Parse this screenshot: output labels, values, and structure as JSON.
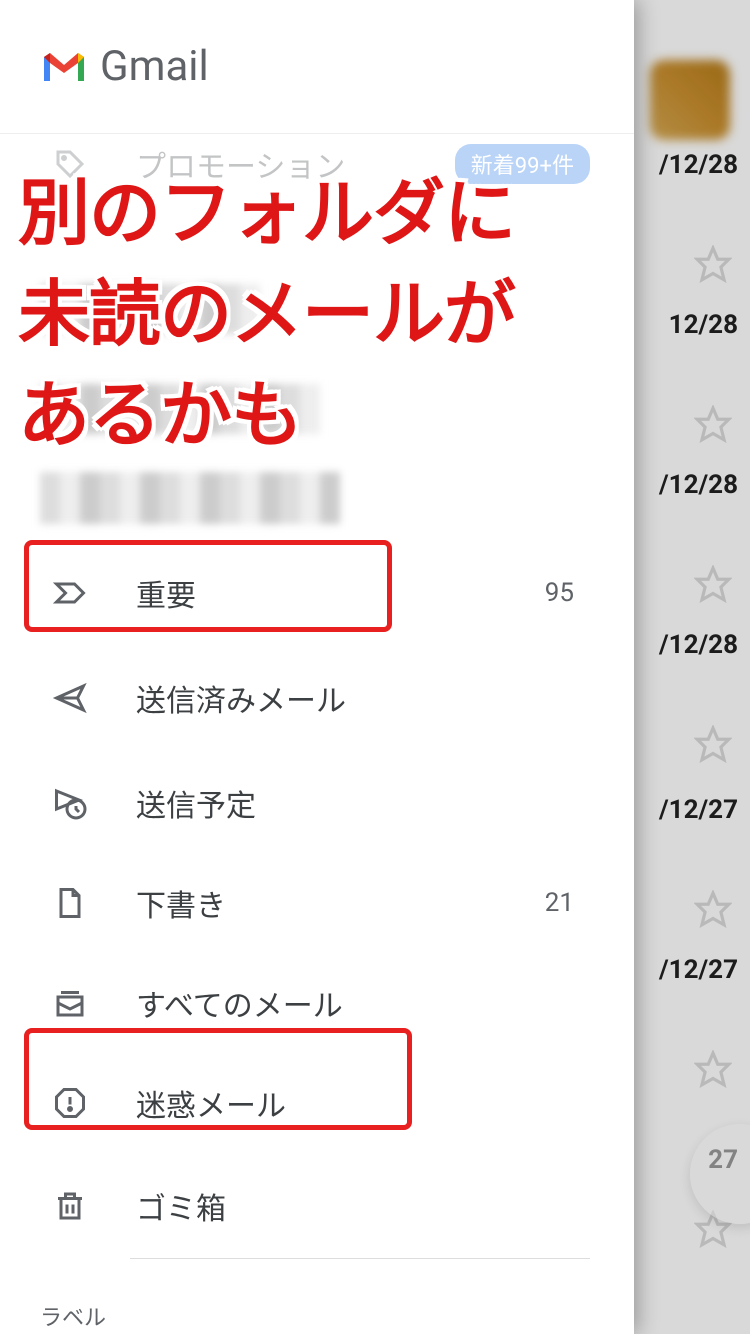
{
  "header": {
    "app_name": "Gmail"
  },
  "nav": {
    "promotions": {
      "label": "プロモーション",
      "badge": "新着99+件"
    },
    "important": {
      "label": "重要",
      "count": "95"
    },
    "sent": {
      "label": "送信済みメール"
    },
    "scheduled": {
      "label": "送信予定"
    },
    "drafts": {
      "label": "下書き",
      "count": "21"
    },
    "all_mail": {
      "label": "すべてのメール"
    },
    "spam": {
      "label": "迷惑メール"
    },
    "trash": {
      "label": "ゴミ箱"
    }
  },
  "section": {
    "labels": "ラベル"
  },
  "annotation": {
    "line1": "別のフォルダに",
    "line2": "未読のメールが",
    "line3": "あるかも"
  },
  "bg_dates": {
    "d1": "/12/28",
    "d2": "12/28",
    "d3": "/12/28",
    "d4": "/12/28",
    "d5": "/12/27",
    "d6": "/12/27",
    "d7": "27"
  }
}
